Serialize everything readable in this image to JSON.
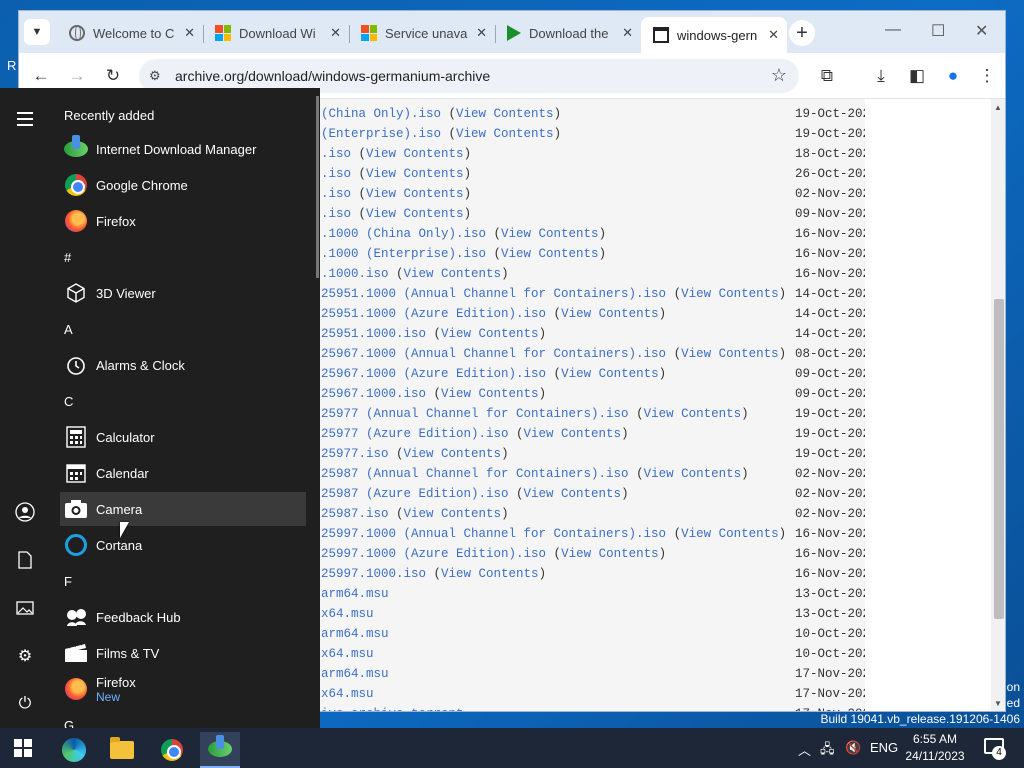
{
  "desktop": {
    "left_letter": "R",
    "watermark_line1": "on",
    "watermark_line2": "ed",
    "build": "Build 19041.vb_release.191206-1406"
  },
  "browser": {
    "tabs": [
      {
        "title": "Welcome to C",
        "icon": "globe-icon"
      },
      {
        "title": "Download Wi",
        "icon": "microsoft-icon"
      },
      {
        "title": "Service unava",
        "icon": "microsoft-icon"
      },
      {
        "title": "Download the",
        "icon": "play-icon"
      },
      {
        "title": "windows-gern",
        "icon": "internet-archive-icon",
        "active": true
      }
    ],
    "url": "archive.org/download/windows-germanium-archive"
  },
  "listing": {
    "view_contents": "View Contents",
    "rows": [
      {
        "file": "(China Only).iso",
        "vc": true,
        "date": "19-Oct-202"
      },
      {
        "file": "(Enterprise).iso",
        "vc": true,
        "date": "19-Oct-202"
      },
      {
        "file": ".iso",
        "vc": true,
        "date": "18-Oct-202"
      },
      {
        "file": ".iso",
        "vc": true,
        "date": "26-Oct-202"
      },
      {
        "file": ".iso",
        "vc": true,
        "date": "02-Nov-202"
      },
      {
        "file": ".iso",
        "vc": true,
        "date": "09-Nov-202"
      },
      {
        "file": ".1000 (China Only).iso",
        "vc": true,
        "date": "16-Nov-202"
      },
      {
        "file": ".1000 (Enterprise).iso",
        "vc": true,
        "date": "16-Nov-202"
      },
      {
        "file": ".1000.iso",
        "vc": true,
        "date": "16-Nov-202"
      },
      {
        "file": "25951.1000 (Annual Channel for Containers).iso",
        "vc": true,
        "date": "14-Oct-202"
      },
      {
        "file": "25951.1000 (Azure Edition).iso",
        "vc": true,
        "date": "14-Oct-202"
      },
      {
        "file": "25951.1000.iso",
        "vc": true,
        "date": "14-Oct-202"
      },
      {
        "file": "25967.1000 (Annual Channel for Containers).iso",
        "vc": true,
        "date": "08-Oct-202"
      },
      {
        "file": "25967.1000 (Azure Edition).iso",
        "vc": true,
        "date": "09-Oct-202"
      },
      {
        "file": "25967.1000.iso",
        "vc": true,
        "date": "09-Oct-202"
      },
      {
        "file": "25977 (Annual Channel for Containers).iso",
        "vc": true,
        "date": "19-Oct-202"
      },
      {
        "file": "25977 (Azure Edition).iso",
        "vc": true,
        "date": "19-Oct-202"
      },
      {
        "file": "25977.iso",
        "vc": true,
        "date": "19-Oct-202"
      },
      {
        "file": "25987 (Annual Channel for Containers).iso",
        "vc": true,
        "date": "02-Nov-202"
      },
      {
        "file": "25987 (Azure Edition).iso",
        "vc": true,
        "date": "02-Nov-202"
      },
      {
        "file": "25987.iso",
        "vc": true,
        "date": "02-Nov-202"
      },
      {
        "file": "25997.1000 (Annual Channel for Containers).iso",
        "vc": true,
        "date": "16-Nov-202"
      },
      {
        "file": "25997.1000 (Azure Edition).iso",
        "vc": true,
        "date": "16-Nov-202"
      },
      {
        "file": "25997.1000.iso",
        "vc": true,
        "date": "16-Nov-202"
      },
      {
        "file": "arm64.msu",
        "vc": false,
        "date": "13-Oct-202"
      },
      {
        "file": "x64.msu",
        "vc": false,
        "date": "13-Oct-202"
      },
      {
        "file": "arm64.msu",
        "vc": false,
        "date": "10-Oct-202"
      },
      {
        "file": "x64.msu",
        "vc": false,
        "date": "10-Oct-202"
      },
      {
        "file": "arm64.msu",
        "vc": false,
        "date": "17-Nov-202"
      },
      {
        "file": "x64.msu",
        "vc": false,
        "date": "17-Nov-202"
      },
      {
        "file": "ive_archive.torrent",
        "vc": false,
        "date": "17-Nov-202"
      }
    ]
  },
  "start_menu": {
    "recently_added": "Recently added",
    "items": [
      {
        "kind": "app",
        "label": "Internet Download Manager",
        "icon": "idm-icon"
      },
      {
        "kind": "app",
        "label": "Google Chrome",
        "icon": "chrome-icon"
      },
      {
        "kind": "app",
        "label": "Firefox",
        "icon": "firefox-icon"
      },
      {
        "kind": "section",
        "label": "#"
      },
      {
        "kind": "app",
        "label": "3D Viewer",
        "icon": "cube-icon"
      },
      {
        "kind": "section",
        "label": "A"
      },
      {
        "kind": "app",
        "label": "Alarms & Clock",
        "icon": "clock-icon"
      },
      {
        "kind": "section",
        "label": "C"
      },
      {
        "kind": "app",
        "label": "Calculator",
        "icon": "calculator-icon"
      },
      {
        "kind": "app",
        "label": "Calendar",
        "icon": "calendar-icon"
      },
      {
        "kind": "app",
        "label": "Camera",
        "icon": "camera-icon",
        "hover": true
      },
      {
        "kind": "app",
        "label": "Cortana",
        "icon": "cortana-icon"
      },
      {
        "kind": "section",
        "label": "F"
      },
      {
        "kind": "app",
        "label": "Feedback Hub",
        "icon": "feedback-icon"
      },
      {
        "kind": "app",
        "label": "Films & TV",
        "icon": "film-icon"
      },
      {
        "kind": "app",
        "label": "Firefox",
        "sub": "New",
        "icon": "firefox-icon"
      },
      {
        "kind": "section",
        "label": "G"
      }
    ]
  },
  "taskbar": {
    "language": "ENG",
    "time": "6:55 AM",
    "date": "24/11/2023",
    "notification_count": "4"
  },
  "colors": {
    "link": "#3b6fc4",
    "start_bg": "#1f1f1f",
    "taskbar_bg": "#1d2737",
    "desktop": "#0b5fae"
  }
}
